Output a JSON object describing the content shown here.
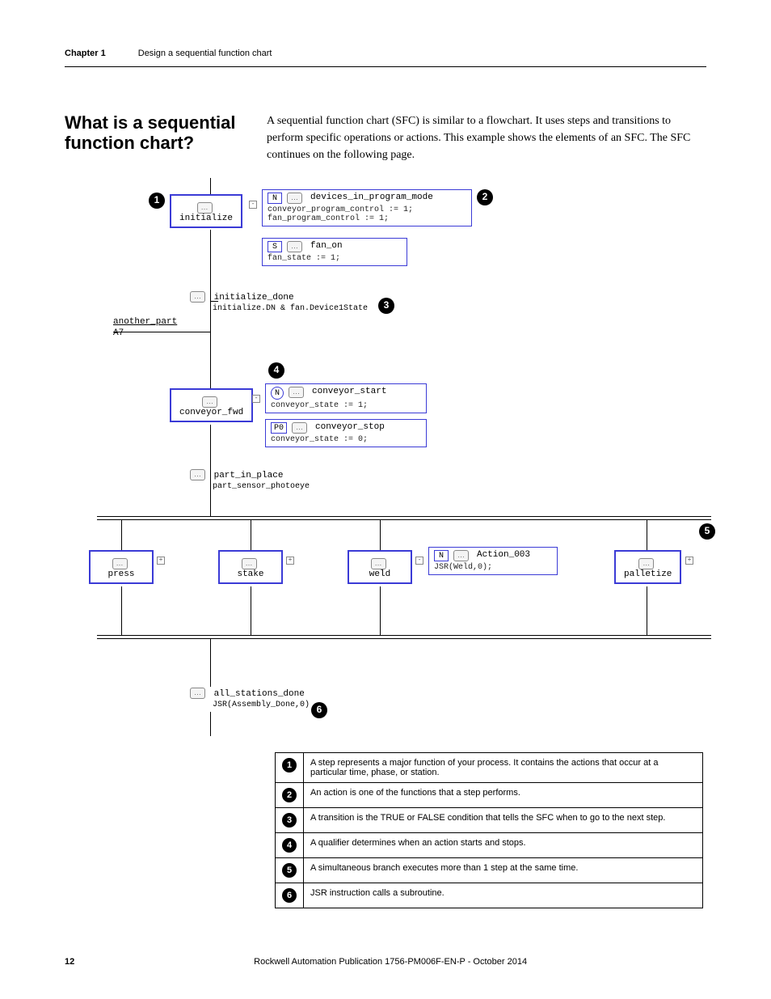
{
  "header": {
    "chapter": "Chapter 1",
    "title": "Design a sequential function chart"
  },
  "section": {
    "heading": "What is a sequential function chart?",
    "intro": "A sequential function chart (SFC) is similar to a flowchart. It uses steps and transitions to perform specific operations or actions. This example shows the elements of an SFC. The SFC continues on the following page."
  },
  "diagram": {
    "link_in": {
      "label": "another_part",
      "ref": "A7"
    },
    "steps": {
      "initialize": {
        "name": "initialize"
      },
      "conveyor_fwd": {
        "name": "conveyor_fwd"
      },
      "press": {
        "name": "press"
      },
      "stake": {
        "name": "stake"
      },
      "weld": {
        "name": "weld"
      },
      "palletize": {
        "name": "palletize"
      }
    },
    "actions": {
      "devices_in_program_mode": {
        "qualifier": "N",
        "name": "devices_in_program_mode",
        "code": "conveyor_program_control := 1;\nfan_program_control := 1;"
      },
      "fan_on": {
        "qualifier": "S",
        "name": "fan_on",
        "code": "fan_state := 1;"
      },
      "conveyor_start": {
        "qualifier": "N",
        "name": "conveyor_start",
        "code": "conveyor_state := 1;"
      },
      "conveyor_stop": {
        "qualifier": "P0",
        "name": "conveyor_stop",
        "code": "conveyor_state := 0;"
      },
      "action_003": {
        "qualifier": "N",
        "name": "Action_003",
        "code": "JSR(Weld,0);"
      }
    },
    "transitions": {
      "initialize_done": {
        "name": "initialize_done",
        "cond": "initialize.DN & fan.Device1State"
      },
      "part_in_place": {
        "name": "part_in_place",
        "cond": "part_sensor_photoeye"
      },
      "all_stations_done": {
        "name": "all_stations_done",
        "cond": "JSR(Assembly_Done,0)"
      }
    },
    "callouts": {
      "c1": "1",
      "c2": "2",
      "c3": "3",
      "c4": "4",
      "c5": "5",
      "c6": "6"
    }
  },
  "legend": [
    {
      "n": "1",
      "text": "A step represents a major function of your process. It contains the actions that occur at a particular time, phase, or station."
    },
    {
      "n": "2",
      "text": "An action is one of the functions that a step performs."
    },
    {
      "n": "3",
      "text": "A transition is the TRUE or FALSE condition that tells the SFC when to go to the next step."
    },
    {
      "n": "4",
      "text": "A qualifier determines when an action starts and stops."
    },
    {
      "n": "5",
      "text": "A simultaneous branch executes more than 1 step at the same time."
    },
    {
      "n": "6",
      "text": "JSR instruction calls a subroutine."
    }
  ],
  "footer": {
    "page": "12",
    "pub": "Rockwell Automation Publication 1756-PM006F-EN-P  - October 2014"
  }
}
